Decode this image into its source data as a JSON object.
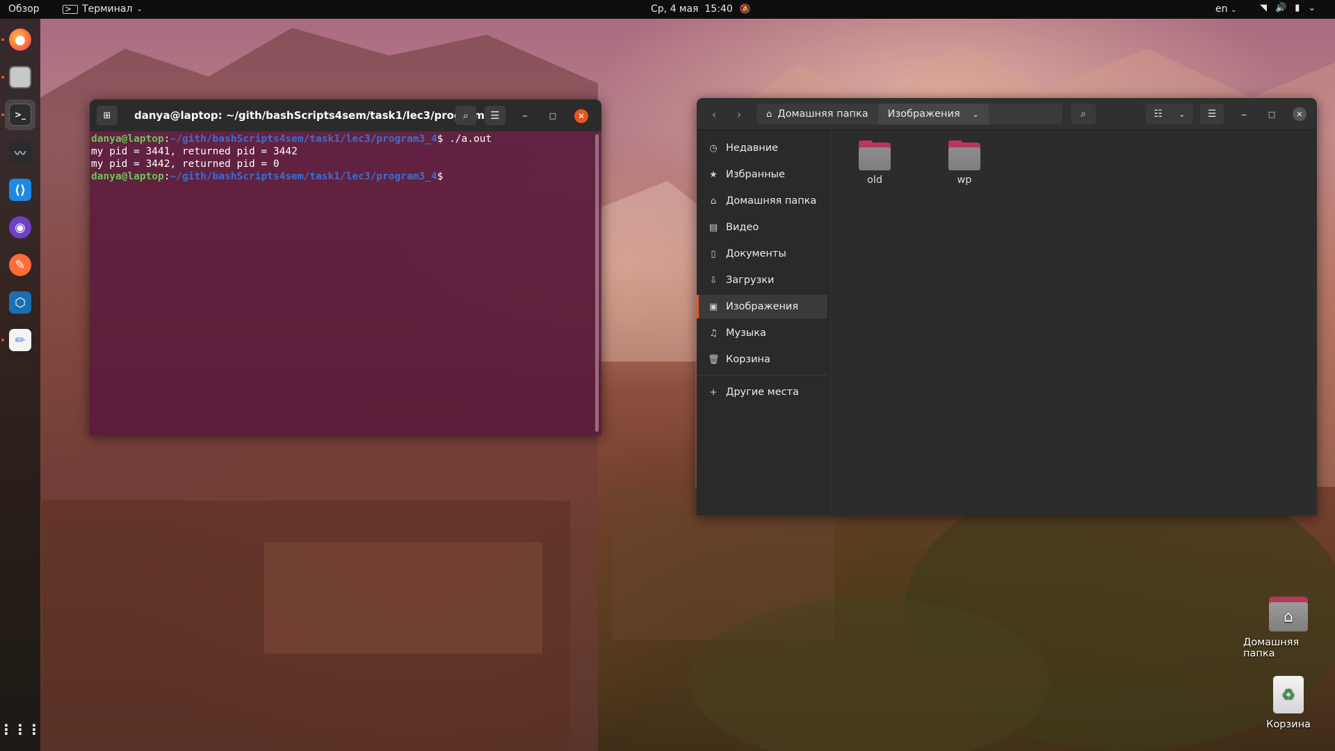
{
  "topbar": {
    "overview": "Обзор",
    "app_name": "Терминал",
    "datetime": "Ср, 4 мая  15:40",
    "lang": "en"
  },
  "dock": {
    "items": [
      {
        "name": "firefox",
        "color": "#ff7139"
      },
      {
        "name": "files",
        "color": "#9b9b9b"
      },
      {
        "name": "terminal",
        "color": "#2d2d2d"
      },
      {
        "name": "system-monitor",
        "color": "#2b2b2b"
      },
      {
        "name": "vscode",
        "color": "#1e88e5"
      },
      {
        "name": "github-desktop",
        "color": "#6e40c9"
      },
      {
        "name": "postman",
        "color": "#ff6c37"
      },
      {
        "name": "virtualbox",
        "color": "#1b6fb3"
      },
      {
        "name": "text-editor",
        "color": "#3c8fe0"
      }
    ],
    "apps_grid": "show-applications"
  },
  "terminal": {
    "title": "danya@laptop: ~/gith/bashScripts4sem/task1/lec3/program...",
    "user_host": "danya@laptop",
    "path": "~/gith/bashScripts4sem/task1/lec3/program3_4",
    "command": "./a.out",
    "prompt_symbol": "$",
    "output_1": "my pid = 3441, returned pid = 3442",
    "output_2": "my pid = 3442, returned pid = 0"
  },
  "files": {
    "path_home": "Домашняя папка",
    "path_current": "Изображения",
    "sidebar": [
      {
        "label": "Недавние",
        "icon": "clock-icon"
      },
      {
        "label": "Избранные",
        "icon": "star-icon"
      },
      {
        "label": "Домашняя папка",
        "icon": "home-icon"
      },
      {
        "label": "Видео",
        "icon": "film-icon"
      },
      {
        "label": "Документы",
        "icon": "document-icon"
      },
      {
        "label": "Загрузки",
        "icon": "download-icon"
      },
      {
        "label": "Изображения",
        "icon": "image-icon"
      },
      {
        "label": "Музыка",
        "icon": "music-icon"
      },
      {
        "label": "Корзина",
        "icon": "trash-icon"
      }
    ],
    "other_places": "Другие места",
    "folders": [
      "old",
      "wp"
    ]
  },
  "desktop": {
    "home_label": "Домашняя папка",
    "trash_label": "Корзина"
  },
  "colors": {
    "accent": "#e95420",
    "terminal_bg": "#58163a",
    "folder_accent": "#b8375b"
  }
}
